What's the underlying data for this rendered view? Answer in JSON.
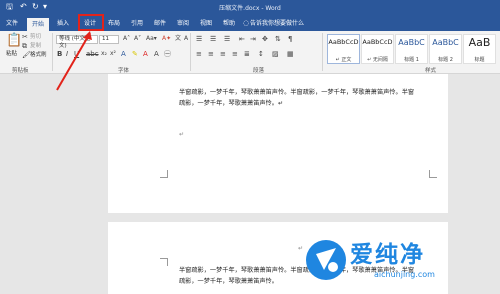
{
  "window": {
    "title": "压缩文件.docx - Word"
  },
  "quick_access": {
    "save": "🖫",
    "undo": "↶",
    "redo": "↻",
    "more": "▾"
  },
  "tabs": [
    {
      "label": "文件"
    },
    {
      "label": "开始"
    },
    {
      "label": "插入"
    },
    {
      "label": "设计"
    },
    {
      "label": "布局"
    },
    {
      "label": "引用"
    },
    {
      "label": "邮件"
    },
    {
      "label": "审阅"
    },
    {
      "label": "视图"
    },
    {
      "label": "帮助"
    }
  ],
  "tell_me": "告诉我你想要做什么",
  "clipboard": {
    "paste": "粘贴",
    "cut": "剪切",
    "copy": "复制",
    "format_painter": "格式刷",
    "group": "剪贴板"
  },
  "font": {
    "name": "等线 (中文正文)",
    "size": "11",
    "group": "字体"
  },
  "paragraph": {
    "group": "段落"
  },
  "styles": {
    "group": "样式",
    "items": [
      {
        "preview": "AaBbCcD",
        "name": "↵ 正文"
      },
      {
        "preview": "AaBbCcD",
        "name": "↵ 无间隔"
      },
      {
        "preview": "AaBbC",
        "name": "标题 1"
      },
      {
        "preview": "AaBbC",
        "name": "标题 2"
      },
      {
        "preview": "AaB",
        "name": "标题"
      }
    ]
  },
  "document": {
    "page1": {
      "p1": "半窗疏影，一梦千年，琴歌萧萧笛声怜。半窗疏影，一梦千年，琴歌萧萧笛声怜。半窗疏影，一梦千年，琴歌萧萧笛声怜。↵",
      "p2": "↵",
      "p3": "↵"
    },
    "page2": {
      "p0": "↵",
      "p1": "半窗疏影，一梦千年，琴歌萧萧笛声怜。半窗疏影，一梦千年，琴歌萧萧笛声怜。半窗疏影，一梦千年，琴歌萧萧笛声怜。"
    }
  },
  "watermark": {
    "name": "爱纯净",
    "url": "aichunjing.com"
  },
  "colors": {
    "ribbon_blue": "#2b579a",
    "highlight_red": "#e2231a",
    "watermark_blue": "#1f86e0"
  }
}
